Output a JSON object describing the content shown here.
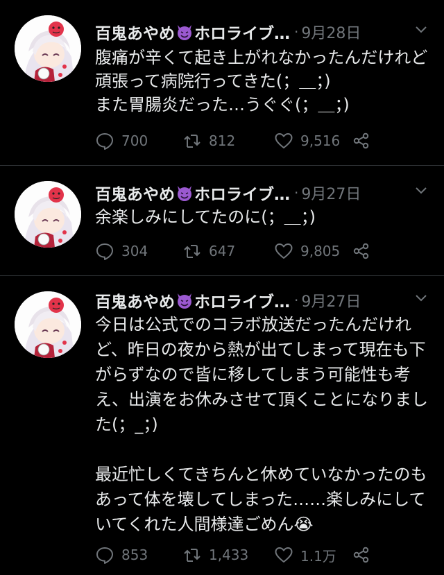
{
  "tweets": [
    {
      "name": "百鬼あやめ",
      "name_suffix": "ホロライブ…",
      "dot": "·",
      "date": "9月28日",
      "text": "腹痛が辛くて起き上がれなかったんだけれど頑張って病院行ってきた(；＿；)\nまた胃腸炎だった…うぐぐ(；＿；)",
      "replies": "700",
      "retweets": "812",
      "likes": "9,516"
    },
    {
      "name": "百鬼あやめ",
      "name_suffix": "ホロライブ…",
      "dot": "·",
      "date": "9月27日",
      "text": "余楽しみにしてたのに(；＿；)",
      "replies": "304",
      "retweets": "647",
      "likes": "9,805"
    },
    {
      "name": "百鬼あやめ",
      "name_suffix": "ホロライブ…",
      "dot": "·",
      "date": "9月27日",
      "text": "今日は公式でのコラボ放送だったんだけれど、昨日の夜から熱が出てしまって現在も下がらずなので皆に移してしまう可能性も考え、出演をお休みさせて頂くことになりました(；_；)\n\n最近忙しくてきちんと休めていなかったのもあって体を壊してしまった……楽しみにしていてくれた人間様達ごめん😭",
      "replies": "853",
      "retweets": "1,433",
      "likes": "1.1万"
    }
  ],
  "colors": {
    "background": "#000000",
    "text": "#e7e9ea",
    "muted": "#71767b",
    "divider": "#2f3336",
    "devil_emoji": "#9b59d0"
  },
  "icons": [
    "avatar",
    "smiling-devil-emoji",
    "chevron-down-icon",
    "reply-icon",
    "retweet-icon",
    "like-icon",
    "share-icon"
  ]
}
